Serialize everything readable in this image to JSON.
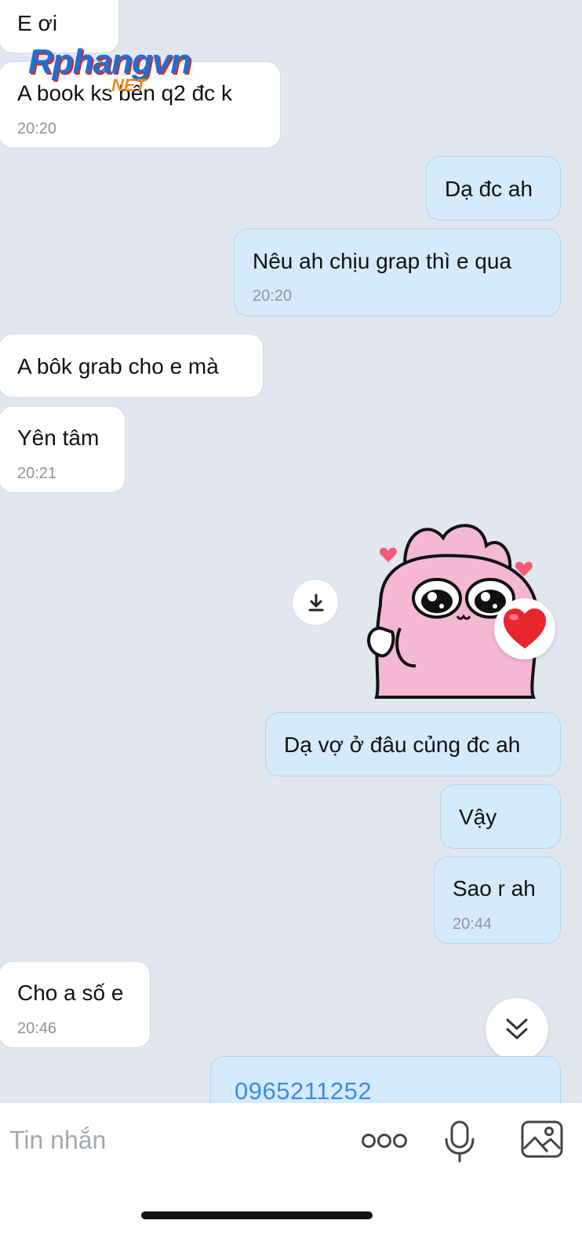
{
  "watermark": {
    "brand": "Rphangvn",
    "suffix": ".NET"
  },
  "messages": [
    {
      "direction": "incoming",
      "text": "E ơi",
      "time": ""
    },
    {
      "direction": "incoming",
      "text": "A book ks bên q2 đc k",
      "time": "20:20"
    },
    {
      "direction": "outgoing",
      "text": "Dạ đc ah",
      "time": ""
    },
    {
      "direction": "outgoing",
      "text": "Nêu ah chịu grap thì e qua",
      "time": "20:20"
    },
    {
      "direction": "incoming",
      "text": "A bôk grab cho e mà",
      "time": ""
    },
    {
      "direction": "incoming",
      "text": "Yên tâm",
      "time": "20:21"
    },
    {
      "direction": "outgoing",
      "text": "Dạ vợ ở đâu củng đc ah",
      "time": ""
    },
    {
      "direction": "outgoing",
      "text": "Vậy",
      "time": ""
    },
    {
      "direction": "outgoing",
      "text": "Sao r ah",
      "time": "20:44"
    },
    {
      "direction": "incoming",
      "text": "Cho a số e",
      "time": "20:46"
    },
    {
      "direction": "outgoing",
      "text": "0965211252",
      "time": ""
    }
  ],
  "sticker": {
    "icon": "pink-bunny-sticker",
    "reaction": "heart-icon"
  },
  "composer": {
    "placeholder": "Tin nhắn",
    "icons": [
      "more-icon",
      "microphone-icon",
      "image-icon"
    ]
  },
  "colors": {
    "background": "#e2e6ee",
    "incoming_bubble": "#ffffff",
    "outgoing_bubble": "#d5ebfb",
    "link": "#3b8ce6"
  }
}
